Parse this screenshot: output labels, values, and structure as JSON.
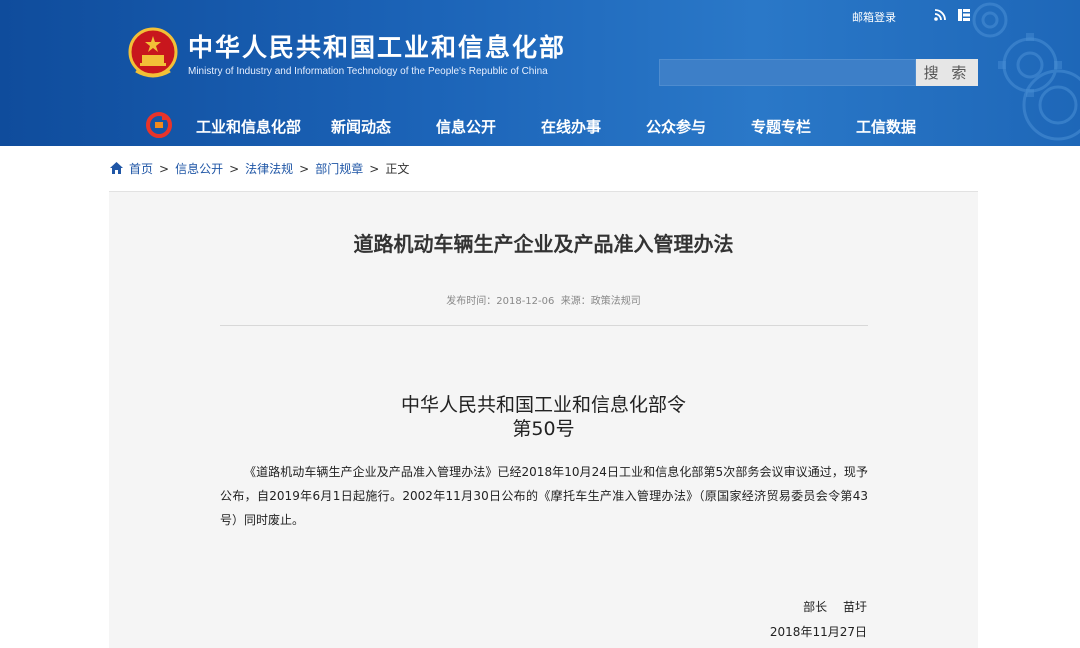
{
  "header": {
    "title": "中华人民共和国工业和信息化部",
    "subtitle": "Ministry of Industry and Information Technology of the People's Republic of China",
    "mail_login": "邮箱登录",
    "icons": [
      "emblem-icon",
      "rss-icon",
      "grid-icon",
      "gear-decoration"
    ],
    "colors": {
      "primary": "#1c64b8",
      "dark": "#0f4c9c"
    }
  },
  "search": {
    "placeholder": "",
    "button_label": "搜 索"
  },
  "nav": {
    "items": [
      {
        "label": "工业和信息化部"
      },
      {
        "label": "新闻动态"
      },
      {
        "label": "信息公开"
      },
      {
        "label": "在线办事"
      },
      {
        "label": "公众参与"
      },
      {
        "label": "专题专栏"
      },
      {
        "label": "工信数据"
      }
    ]
  },
  "breadcrumb": {
    "items": [
      "首页",
      "信息公开",
      "法律法规",
      "部门规章"
    ],
    "current": "正文",
    "separator": ">"
  },
  "article": {
    "title": "道路机动车辆生产企业及产品准入管理办法",
    "meta": "发布时间：2018-12-06  来源：政策法规司",
    "decree": "中华人民共和国工业和信息化部令",
    "decree_no": "第50号",
    "body": "《道路机动车辆生产企业及产品准入管理办法》已经2018年10月24日工业和信息化部第5次部务会议审议通过，现予公布，自2019年6月1日起施行。2002年11月30日公布的《摩托车生产准入管理办法》（原国家经济贸易委员会令第43号）同时废止。",
    "signer": "部长　 苗圩",
    "date": "2018年11月27日"
  }
}
